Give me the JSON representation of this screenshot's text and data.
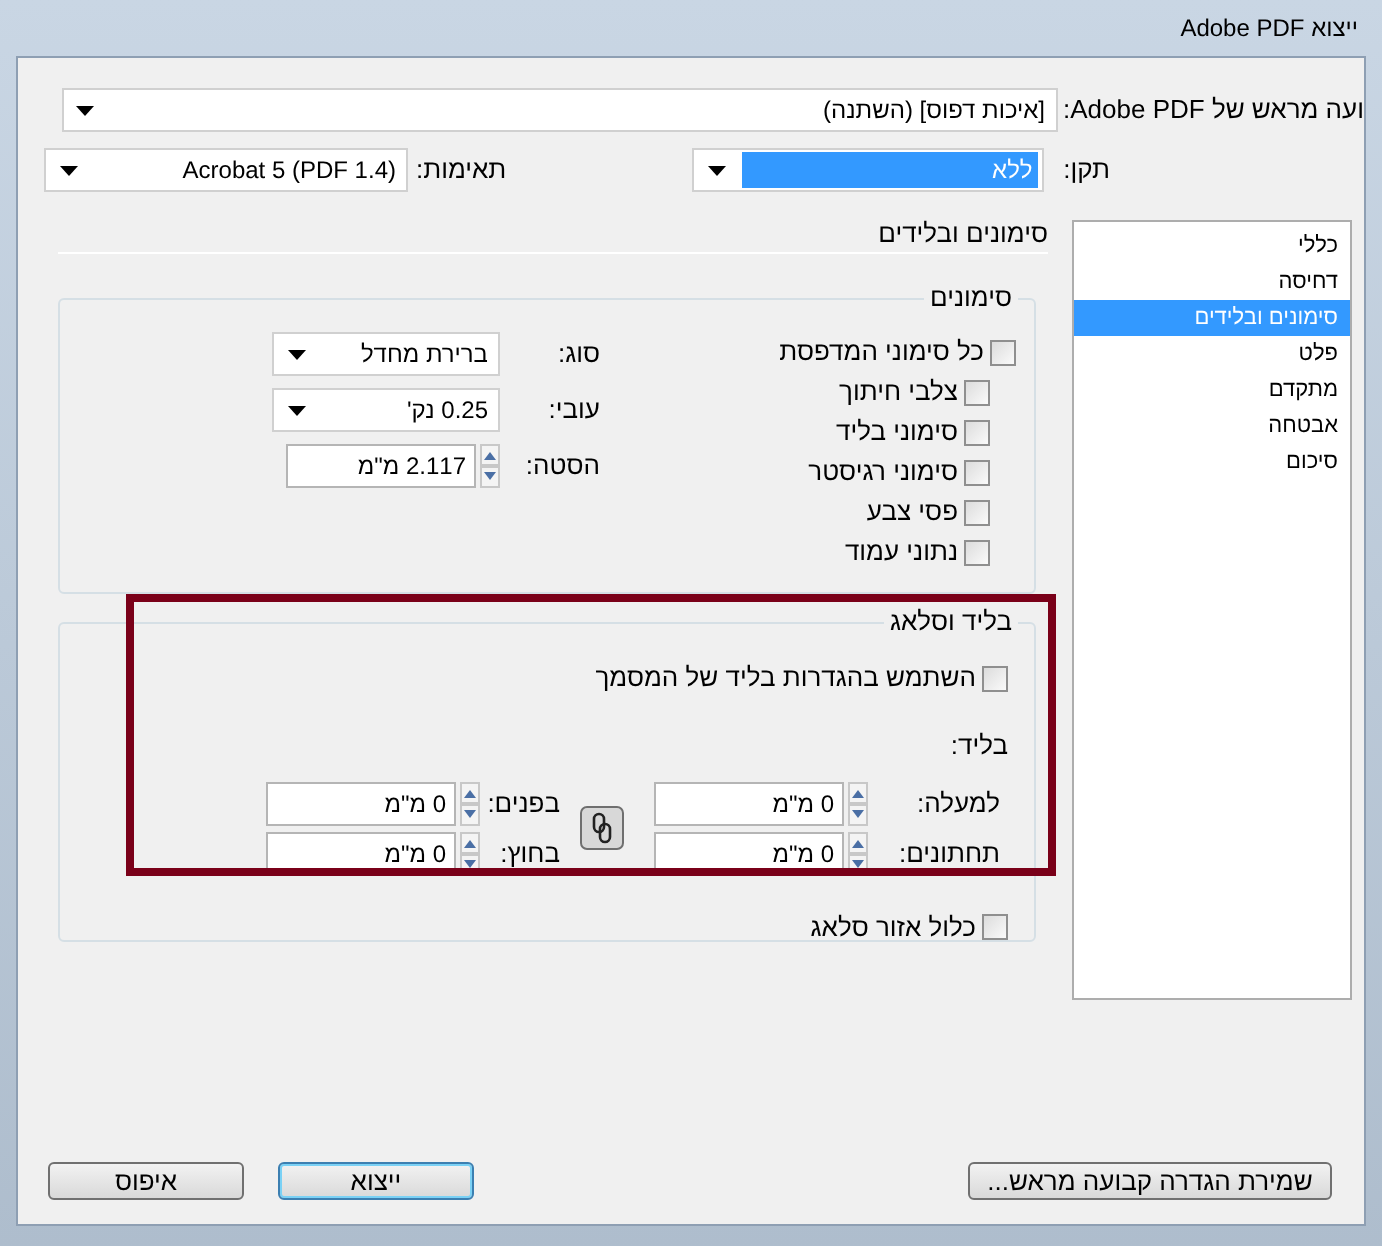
{
  "window": {
    "title": "ייצוא Adobe PDF"
  },
  "preset": {
    "label": "ועה מראש של Adobe PDF:",
    "value": "[איכות דפוס] (השתנה)"
  },
  "standard": {
    "label": "תקן:",
    "value": "ללא",
    "selected": true
  },
  "compatibility": {
    "label": "תאימות:",
    "value": "Acrobat 5 (PDF 1.4)"
  },
  "sidebar": {
    "items": [
      {
        "label": "כללי",
        "selected": false
      },
      {
        "label": "דחיסה",
        "selected": false
      },
      {
        "label": "סימונים ובלידים",
        "selected": true
      },
      {
        "label": "פלט",
        "selected": false
      },
      {
        "label": "מתקדם",
        "selected": false
      },
      {
        "label": "אבטחה",
        "selected": false
      },
      {
        "label": "סיכום",
        "selected": false
      }
    ]
  },
  "section_title": "סימונים ובלידים",
  "marks": {
    "title": "סימונים",
    "all": {
      "label": "כל סימוני המדפסת",
      "checked": false,
      "children": [
        {
          "label": "צלבי חיתוך",
          "checked": false
        },
        {
          "label": "סימוני בליד",
          "checked": false
        },
        {
          "label": "סימוני רגיסטר",
          "checked": false
        },
        {
          "label": "פסי צבע",
          "checked": false
        },
        {
          "label": "נתוני עמוד",
          "checked": false
        }
      ]
    },
    "fields": [
      {
        "kind": "dropdown",
        "label": "סוג:",
        "value": "ברירת מחדל"
      },
      {
        "kind": "dropdown",
        "label": "עובי:",
        "value": "0.25 נק'"
      },
      {
        "kind": "spinner",
        "label": "הסטה:",
        "value": "2.117 מ\"מ"
      }
    ]
  },
  "bleed": {
    "title": "בליד וסלאג",
    "use_document": {
      "label": "השתמש בהגדרות בליד של המסמך",
      "checked": false
    },
    "subtitle": "בליד:",
    "fields": [
      {
        "label": "למעלה:",
        "value": "0 מ\"מ"
      },
      {
        "label": "בפנים:",
        "value": "0 מ\"מ"
      },
      {
        "label": "תחתונים:",
        "value": "0 מ\"מ"
      },
      {
        "label": "בחוץ:",
        "value": "0 מ\"מ"
      }
    ]
  },
  "slug": {
    "label": "כלול אזור סלאג",
    "checked": false
  },
  "buttons": [
    {
      "kind": "normal",
      "label": "שמירת הגדרה קבועה מראש..."
    },
    {
      "kind": "default",
      "label": "ייצוא"
    },
    {
      "kind": "normal",
      "label": "איפוס"
    }
  ]
}
